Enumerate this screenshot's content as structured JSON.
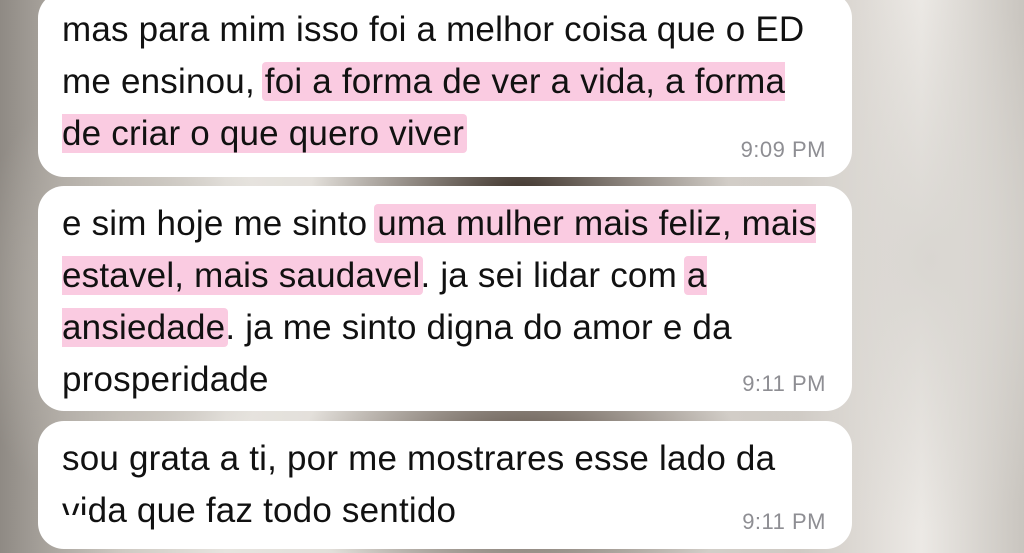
{
  "messages": [
    {
      "segments": [
        {
          "text": "mas para mim isso foi a melhor coisa que o ED me ensinou, ",
          "highlight": false
        },
        {
          "text": "foi a forma de ver a vida, a forma de criar o que quero viver",
          "highlight": true
        }
      ],
      "time": "9:09 PM"
    },
    {
      "segments": [
        {
          "text": "e sim hoje me sinto ",
          "highlight": false
        },
        {
          "text": "uma mulher mais feliz, mais estavel, mais saudavel",
          "highlight": true
        },
        {
          "text": ". ja sei lidar com ",
          "highlight": false
        },
        {
          "text": "a ansiedade",
          "highlight": true
        },
        {
          "text": ". ja me sinto digna do amor e da prosperidade",
          "highlight": false
        }
      ],
      "time": "9:11 PM"
    },
    {
      "segments": [
        {
          "text": "sou grata a ti, por me mostrares esse lado da vida que faz todo sentido",
          "highlight": false
        }
      ],
      "time": "9:11 PM"
    }
  ],
  "colors": {
    "bubble": "#ffffff",
    "text": "#111111",
    "timestamp": "#8e8e93",
    "highlight": "#f5a0c8"
  }
}
